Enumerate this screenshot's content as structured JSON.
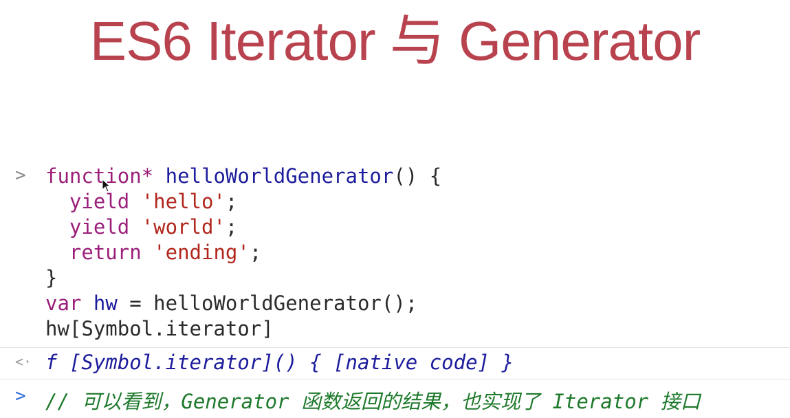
{
  "slide": {
    "title": "ES6 Iterator 与 Generator"
  },
  "console": {
    "input_prompt": ">",
    "output_prompt": "<·",
    "code_lines": [
      [
        {
          "t": "function*",
          "c": "kw"
        },
        {
          "t": " ",
          "c": "plain"
        },
        {
          "t": "helloWorldGenerator",
          "c": "fn"
        },
        {
          "t": "() {",
          "c": "plain"
        }
      ],
      [
        {
          "t": "  ",
          "c": "plain"
        },
        {
          "t": "yield",
          "c": "kw"
        },
        {
          "t": " ",
          "c": "plain"
        },
        {
          "t": "'hello'",
          "c": "str"
        },
        {
          "t": ";",
          "c": "plain"
        }
      ],
      [
        {
          "t": "  ",
          "c": "plain"
        },
        {
          "t": "yield",
          "c": "kw"
        },
        {
          "t": " ",
          "c": "plain"
        },
        {
          "t": "'world'",
          "c": "str"
        },
        {
          "t": ";",
          "c": "plain"
        }
      ],
      [
        {
          "t": "  ",
          "c": "plain"
        },
        {
          "t": "return",
          "c": "kw"
        },
        {
          "t": " ",
          "c": "plain"
        },
        {
          "t": "'ending'",
          "c": "str"
        },
        {
          "t": ";",
          "c": "plain"
        }
      ],
      [
        {
          "t": "}",
          "c": "plain"
        }
      ],
      [
        {
          "t": "var",
          "c": "kw"
        },
        {
          "t": " ",
          "c": "plain"
        },
        {
          "t": "hw",
          "c": "fn"
        },
        {
          "t": " = helloWorldGenerator();",
          "c": "plain"
        }
      ],
      [
        {
          "t": "hw[Symbol.iterator]",
          "c": "plain"
        }
      ]
    ],
    "result_text": "f [Symbol.iterator]() { [native code] }",
    "comment_prompt": ">",
    "comment_text": "// 可以看到，Generator 函数返回的结果，也实现了 Iterator 接口"
  },
  "colors": {
    "title": "#b8434f",
    "keyword": "#9b1f7a",
    "function_name": "#1c1c9c",
    "string": "#b1261c",
    "comment": "#1e7a2c",
    "prompt_blue": "#2f6fd6"
  },
  "icons": {
    "cursor": "mouse-pointer-icon"
  }
}
